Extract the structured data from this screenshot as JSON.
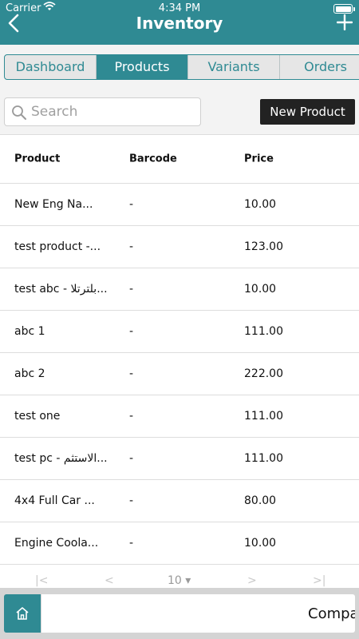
{
  "status_bar": {
    "carrier": "Carrier",
    "time": "4:34 PM"
  },
  "header": {
    "title": "Inventory"
  },
  "tabs": [
    {
      "label": "Dashboard"
    },
    {
      "label": "Products"
    },
    {
      "label": "Variants"
    },
    {
      "label": "Orders"
    }
  ],
  "active_tab": "Products",
  "search": {
    "placeholder": "Search"
  },
  "new_product_label": "New Product",
  "table": {
    "headers": [
      "Product",
      "Barcode",
      "Price"
    ],
    "rows": [
      {
        "product": "New Eng Na...",
        "barcode": "-",
        "price": "10.00"
      },
      {
        "product": "test product -...",
        "barcode": "-",
        "price": "123.00"
      },
      {
        "product": "test abc - بلترتلا...",
        "barcode": "-",
        "price": "10.00"
      },
      {
        "product": "abc 1",
        "barcode": "-",
        "price": "111.00"
      },
      {
        "product": "abc 2",
        "barcode": "-",
        "price": "222.00"
      },
      {
        "product": "test one",
        "barcode": "-",
        "price": "111.00"
      },
      {
        "product": "test pc - الاستثم...",
        "barcode": "-",
        "price": "111.00"
      },
      {
        "product": "4x4 Full Car ...",
        "barcode": "-",
        "price": "80.00"
      },
      {
        "product": "Engine Coola...",
        "barcode": "-",
        "price": "10.00"
      }
    ]
  },
  "pagination": {
    "page_size": "10"
  },
  "bottom_bar": {
    "company_label": "Company"
  },
  "colors": {
    "accent": "#2f8a93",
    "button_dark": "#222222"
  }
}
